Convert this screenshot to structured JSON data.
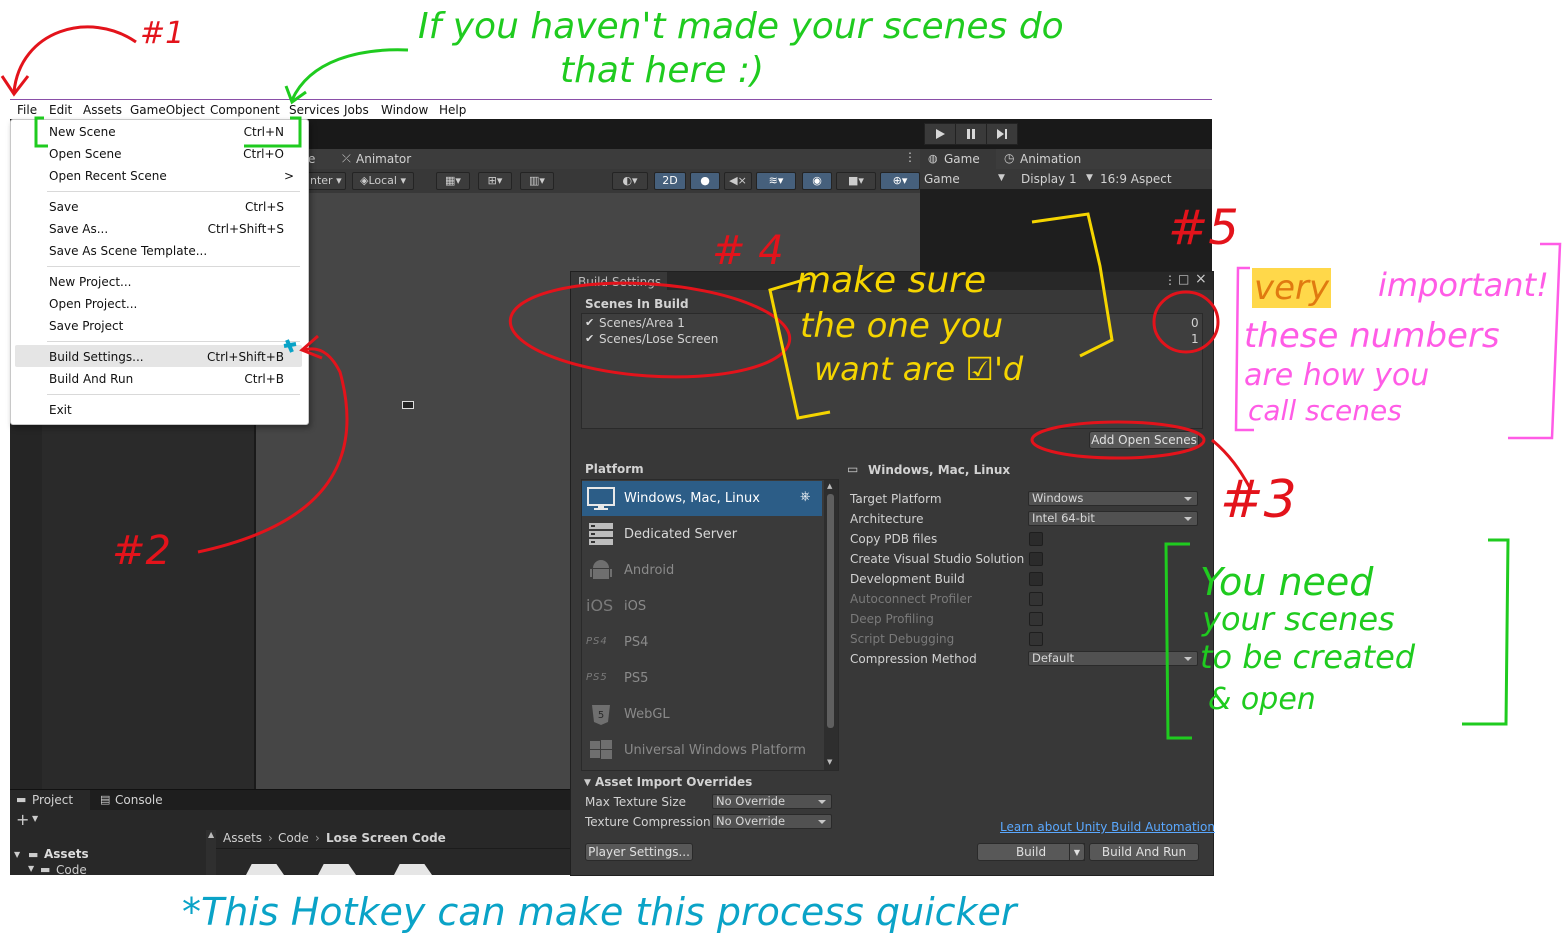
{
  "menubar": {
    "items": [
      "File",
      "Edit",
      "Assets",
      "GameObject",
      "Component",
      "Services",
      "Jobs",
      "Window",
      "Help"
    ]
  },
  "file_menu": {
    "items": [
      {
        "label": "New Scene",
        "shortcut": "Ctrl+N"
      },
      {
        "label": "Open Scene",
        "shortcut": "Ctrl+O"
      },
      {
        "label": "Open Recent Scene",
        "shortcut": ">"
      },
      {
        "label": "Save",
        "shortcut": "Ctrl+S"
      },
      {
        "label": "Save As...",
        "shortcut": "Ctrl+Shift+S"
      },
      {
        "label": "Save As Scene Template...",
        "shortcut": ""
      },
      {
        "label": "New Project...",
        "shortcut": ""
      },
      {
        "label": "Open Project...",
        "shortcut": ""
      },
      {
        "label": "Save Project",
        "shortcut": ""
      },
      {
        "label": "Build Settings...",
        "shortcut": "Ctrl+Shift+B"
      },
      {
        "label": "Build And Run",
        "shortcut": "Ctrl+B"
      },
      {
        "label": "Exit",
        "shortcut": ""
      }
    ]
  },
  "scene_toolbar": {
    "tab_scene_partial": "e",
    "tab_animator": "Animator",
    "pivot_partial": "nter",
    "local": "Local",
    "btn_2d": "2D"
  },
  "game_view": {
    "tab_game": "Game",
    "tab_animation": "Animation",
    "game_dropdown": "Game",
    "display": "Display 1",
    "aspect": "16:9 Aspect"
  },
  "build_settings": {
    "title": "Build Settings",
    "scenes_header": "Scenes In Build",
    "scenes": [
      {
        "name": "Scenes/Area 1",
        "index": "0",
        "checked": true
      },
      {
        "name": "Scenes/Lose Screen",
        "index": "1",
        "checked": true
      }
    ],
    "add_open_scenes": "Add Open Scenes",
    "platform_header": "Platform",
    "platforms": [
      {
        "label": "Windows, Mac, Linux",
        "icon": "monitor-icon",
        "selected": true,
        "enabled": true
      },
      {
        "label": "Dedicated Server",
        "icon": "server-icon",
        "selected": false,
        "enabled": true
      },
      {
        "label": "Android",
        "icon": "android-icon",
        "selected": false,
        "enabled": false
      },
      {
        "label": "iOS",
        "icon": "ios-icon",
        "icon_text": "iOS",
        "selected": false,
        "enabled": false
      },
      {
        "label": "PS4",
        "icon": "ps4-icon",
        "icon_text": "PS4",
        "selected": false,
        "enabled": false
      },
      {
        "label": "PS5",
        "icon": "ps5-icon",
        "icon_text": "PS5",
        "selected": false,
        "enabled": false
      },
      {
        "label": "WebGL",
        "icon": "html5-icon",
        "selected": false,
        "enabled": false
      },
      {
        "label": "Universal Windows Platform",
        "icon": "windows-icon",
        "selected": false,
        "enabled": false
      }
    ],
    "platform_title": "Windows, Mac, Linux",
    "settings": [
      {
        "label": "Target Platform",
        "type": "dropdown",
        "value": "Windows",
        "enabled": true
      },
      {
        "label": "Architecture",
        "type": "dropdown",
        "value": "Intel 64-bit",
        "enabled": true
      },
      {
        "label": "Copy PDB files",
        "type": "checkbox",
        "enabled": true
      },
      {
        "label": "Create Visual Studio Solution",
        "type": "checkbox",
        "enabled": true
      },
      {
        "label": "Development Build",
        "type": "checkbox",
        "enabled": true
      },
      {
        "label": "Autoconnect Profiler",
        "type": "checkbox",
        "enabled": false
      },
      {
        "label": "Deep Profiling",
        "type": "checkbox",
        "enabled": false
      },
      {
        "label": "Script Debugging",
        "type": "checkbox",
        "enabled": false
      },
      {
        "label": "Compression Method",
        "type": "dropdown",
        "value": "Default",
        "enabled": true
      }
    ],
    "asset_overrides_header": "Asset Import Overrides",
    "max_texture_label": "Max Texture Size",
    "max_texture_value": "No Override",
    "texture_compression_label": "Texture Compression",
    "texture_compression_value": "No Override",
    "learn_link": "Learn about Unity Build Automation",
    "player_settings": "Player Settings...",
    "build": "Build",
    "build_and_run": "Build And Run"
  },
  "project_panel": {
    "tab_project": "Project",
    "tab_console": "Console",
    "add": "+",
    "breadcrumb": [
      "Assets",
      "Code",
      "Lose Screen Code"
    ],
    "tree_assets": "Assets",
    "tree_code": "Code"
  },
  "annotations": {
    "n1": "#1",
    "green_top_1": "If you haven't made your scenes do",
    "green_top_2": "that here :)",
    "n2": "#2",
    "n3": "#3",
    "n4": "# 4",
    "n5": "#5",
    "yellow_1": "make sure",
    "yellow_2": "the one you",
    "yellow_3": "want are ☑'d",
    "pink_very": "very",
    "pink_1": "important!",
    "pink_2": "these numbers",
    "pink_3": "are how you",
    "pink_4": "call scenes",
    "green_right_1": "You need",
    "green_right_2": "your scenes",
    "green_right_3": "to be created",
    "green_right_4": "& open",
    "blue_bottom": "*This Hotkey can make this process quicker",
    "colors": {
      "red": "#e3131b",
      "green": "#1fcb1f",
      "yellow": "#f5d500",
      "pink": "#ff5ce6",
      "blue": "#0aa3c7",
      "highlight": "#ffd84a"
    }
  }
}
